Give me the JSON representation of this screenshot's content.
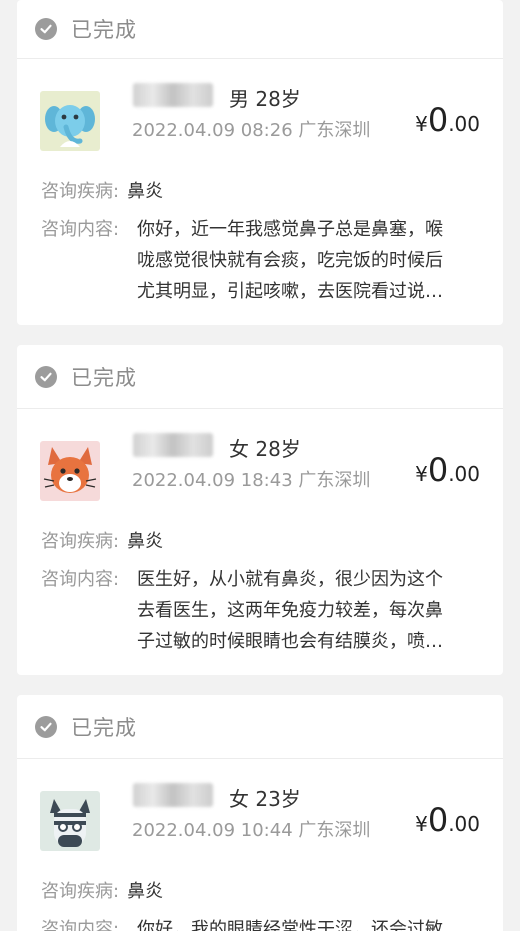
{
  "cards": [
    {
      "status": "已完成",
      "gender_age": "男 28岁",
      "datetime": "2022.04.09 08:26 广东深圳",
      "price": {
        "currency": "¥",
        "integer": "0",
        "decimal": ".00"
      },
      "disease_label": "咨询疾病:",
      "disease_value": "鼻炎",
      "content_label": "咨询内容:",
      "content_lines": [
        "你好，近一年我感觉鼻子总是鼻塞，喉",
        "咙感觉很快就有会痰，吃完饭的时候后",
        "尤其明显，引起咳嗽，去医院看过说…"
      ],
      "avatar": "elephant-avatar"
    },
    {
      "status": "已完成",
      "gender_age": "女 28岁",
      "datetime": "2022.04.09 18:43 广东深圳",
      "price": {
        "currency": "¥",
        "integer": "0",
        "decimal": ".00"
      },
      "disease_label": "咨询疾病:",
      "disease_value": "鼻炎",
      "content_label": "咨询内容:",
      "content_lines": [
        "医生好，从小就有鼻炎，很少因为这个",
        "去看医生，这两年免疫力较差，每次鼻",
        "子过敏的时候眼睛也会有结膜炎，喷…"
      ],
      "avatar": "fox-avatar"
    },
    {
      "status": "已完成",
      "gender_age": "女 23岁",
      "datetime": "2022.04.09 10:44 广东深圳",
      "price": {
        "currency": "¥",
        "integer": "0",
        "decimal": ".00"
      },
      "disease_label": "咨询疾病:",
      "disease_value": "鼻炎",
      "content_label": "咨询内容:",
      "content_lines": [
        "你好，我的眼睛经常性干涩，还会过敏"
      ],
      "avatar": "zebra-avatar"
    }
  ],
  "colors": {
    "background": "#f2f2f2",
    "card": "#ffffff",
    "status_gray": "#8c8c8c",
    "check_gray": "#9c9c9c",
    "text_dark": "#333333",
    "text_gray": "#9a9a9a"
  }
}
